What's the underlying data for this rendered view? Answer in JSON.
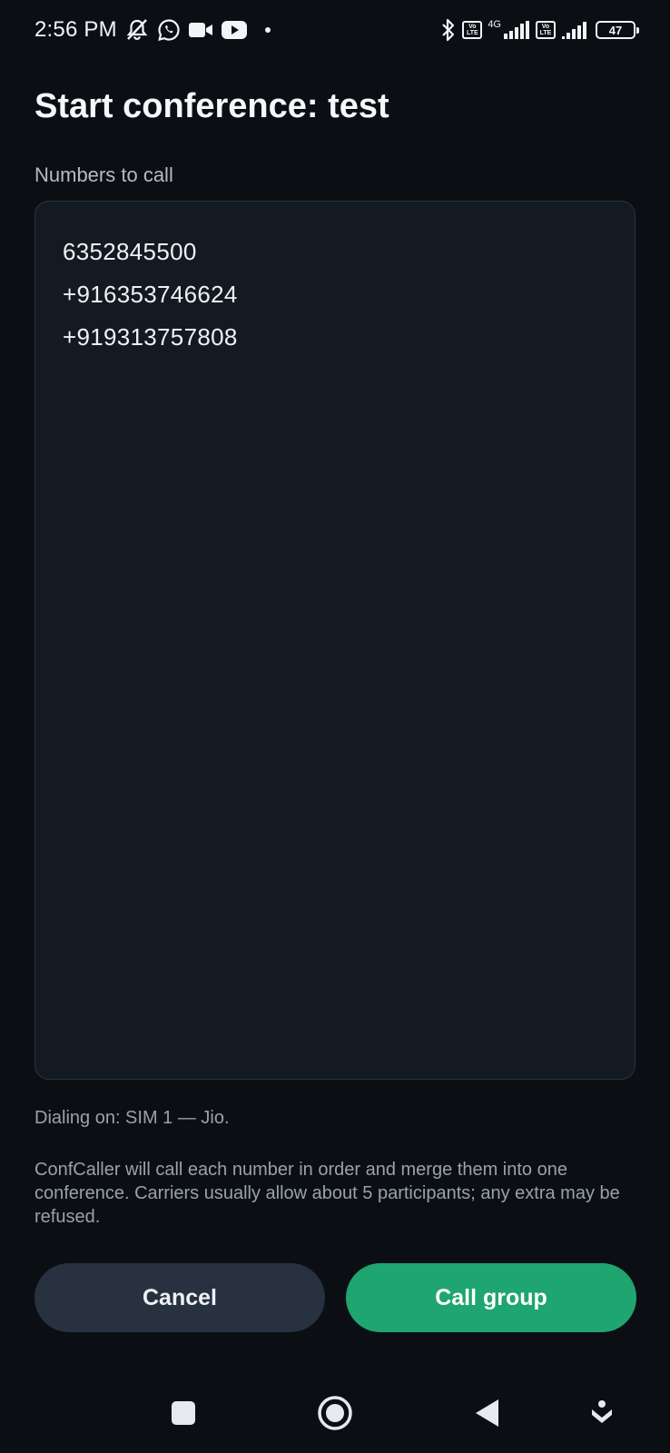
{
  "status_bar": {
    "time": "2:56 PM",
    "icons_left": [
      "bell-off-icon",
      "whatsapp-icon",
      "video-camera-icon",
      "youtube-icon",
      "dot-icon"
    ],
    "bluetooth": "bluetooth-icon",
    "volte_label_top": "Vo",
    "volte_label_bottom": "LTE",
    "network_type": "4G",
    "battery_level": "47"
  },
  "header": {
    "title": "Start conference: test"
  },
  "form": {
    "numbers_label": "Numbers to call",
    "numbers": [
      "6352845500",
      "+916353746624",
      "+919313757808"
    ]
  },
  "info": {
    "dialing": "Dialing on: SIM 1 — Jio.",
    "help": "ConfCaller will call each number in order and merge them into one conference. Carriers usually allow about 5 participants; any extra may be refused."
  },
  "actions": {
    "cancel_label": "Cancel",
    "call_label": "Call group"
  },
  "colors": {
    "background": "#0b0f14",
    "field_bg": "#141a22",
    "cancel_bg": "#283140",
    "accent": "#1fa56f"
  },
  "navbar": {
    "icons": [
      "recents-square-icon",
      "home-circle-icon",
      "back-triangle-icon",
      "nav-down-icon"
    ]
  }
}
